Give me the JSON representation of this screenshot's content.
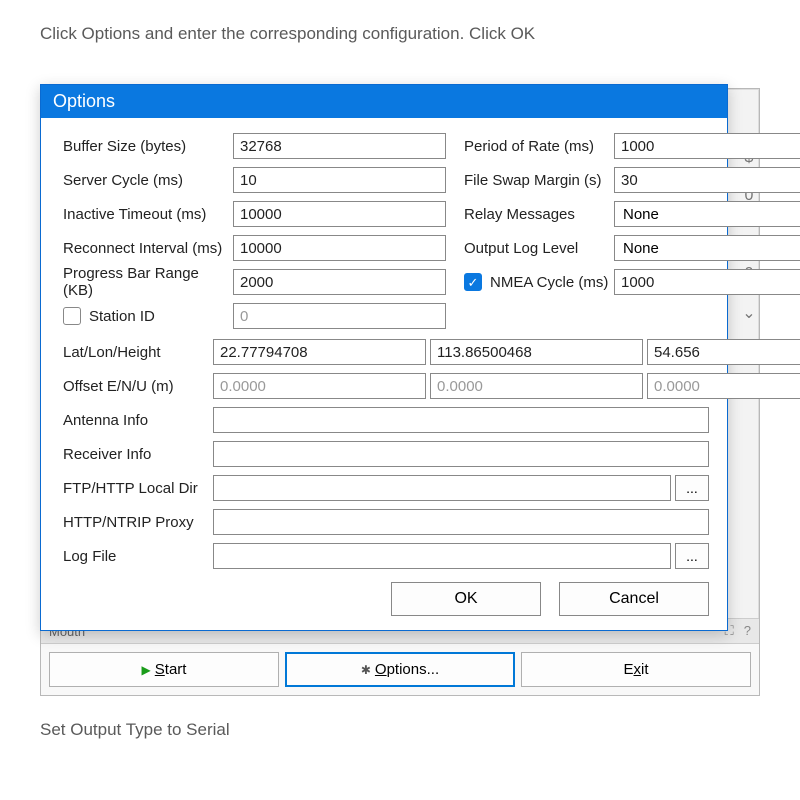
{
  "caption_top": "Click Options and enter the corresponding configuration. Click OK",
  "caption_bottom": "Set Output Type to Serial",
  "dialog": {
    "title": "Options",
    "left": {
      "buffer_size_label": "Buffer Size (bytes)",
      "buffer_size_value": "32768",
      "server_cycle_label": "Server Cycle  (ms)",
      "server_cycle_value": "10",
      "inactive_timeout_label": "Inactive Timeout (ms)",
      "inactive_timeout_value": "10000",
      "reconnect_interval_label": "Reconnect Interval  (ms)",
      "reconnect_interval_value": "10000",
      "progress_bar_range_label": "Progress Bar Range (KB)",
      "progress_bar_range_value": "2000",
      "station_id_label": "Station ID",
      "station_id_checked": false,
      "station_id_value": "0"
    },
    "right": {
      "period_rate_label": "Period of Rate (ms)",
      "period_rate_value": "1000",
      "file_swap_label": "File Swap Margin (s)",
      "file_swap_value": "30",
      "relay_messages_label": "Relay Messages",
      "relay_messages_value": "None",
      "output_log_label": "Output Log Level",
      "output_log_value": "None",
      "nmea_cycle_label": "NMEA Cycle (ms)",
      "nmea_cycle_checked": true,
      "nmea_cycle_value": "1000"
    },
    "full": {
      "latlon_label": "Lat/Lon/Height",
      "lat": "22.77794708",
      "lon": "113.86500468",
      "hgt": "54.656",
      "offset_label": "Offset E/N/U (m)",
      "off_e": "0.0000",
      "off_n": "0.0000",
      "off_u": "0.0000",
      "antenna_label": "Antenna Info",
      "antenna_value": "",
      "receiver_label": "Receiver Info",
      "receiver_value": "",
      "ftp_label": "FTP/HTTP Local Dir",
      "ftp_value": "",
      "proxy_label": "HTTP/NTRIP Proxy",
      "proxy_value": "",
      "log_label": "Log File",
      "log_value": ""
    },
    "ok_label": "OK",
    "cancel_label": "Cancel",
    "dots_label": "..."
  },
  "bgwin": {
    "mouth_label": "Mouth",
    "expand_icon": "⛶",
    "help_icon": "?",
    "start_label": "Start",
    "options_label": "Options...",
    "exit_label": "Exit",
    "side_glyphs": [
      "$",
      "⌄",
      "0",
      "⌄",
      "0",
      "⌄"
    ]
  }
}
